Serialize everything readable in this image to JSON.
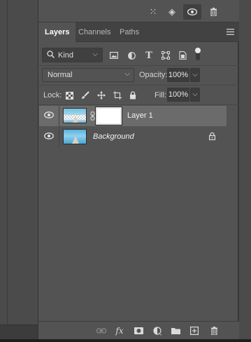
{
  "tabs": [
    {
      "label": "Layers",
      "active": true
    },
    {
      "label": "Channels",
      "active": false
    },
    {
      "label": "Paths",
      "active": false
    }
  ],
  "top_toolbar": {
    "icons": [
      "selection-icon",
      "pin-icon",
      "eye-icon",
      "trash-icon"
    ]
  },
  "filter": {
    "kind_label": "Kind",
    "icons": [
      "image-filter-icon",
      "adjustment-filter-icon",
      "type-filter-icon",
      "shape-filter-icon",
      "smart-object-filter-icon"
    ],
    "toggle_on": true
  },
  "blend": {
    "mode": "Normal",
    "opacity_label": "Opacity:",
    "opacity_value": "100%"
  },
  "lock_row": {
    "lock_label": "Lock:",
    "fill_label": "Fill:",
    "fill_value": "100%"
  },
  "layers": [
    {
      "name": "Layer 1",
      "visible": true,
      "selected": true,
      "has_mask": true,
      "locked": false
    },
    {
      "name": "Background",
      "visible": true,
      "selected": false,
      "has_mask": false,
      "locked": true
    }
  ],
  "footer_icons": [
    "link-layers-icon",
    "fx-icon",
    "add-mask-icon",
    "adjustment-layer-icon",
    "group-folder-icon",
    "new-layer-icon",
    "delete-layer-icon"
  ],
  "fx_label": "fx",
  "colors": {
    "panel_bg": "#535353",
    "tab_bar_bg": "#424242",
    "selected_layer_bg": "#6b6b6b"
  }
}
